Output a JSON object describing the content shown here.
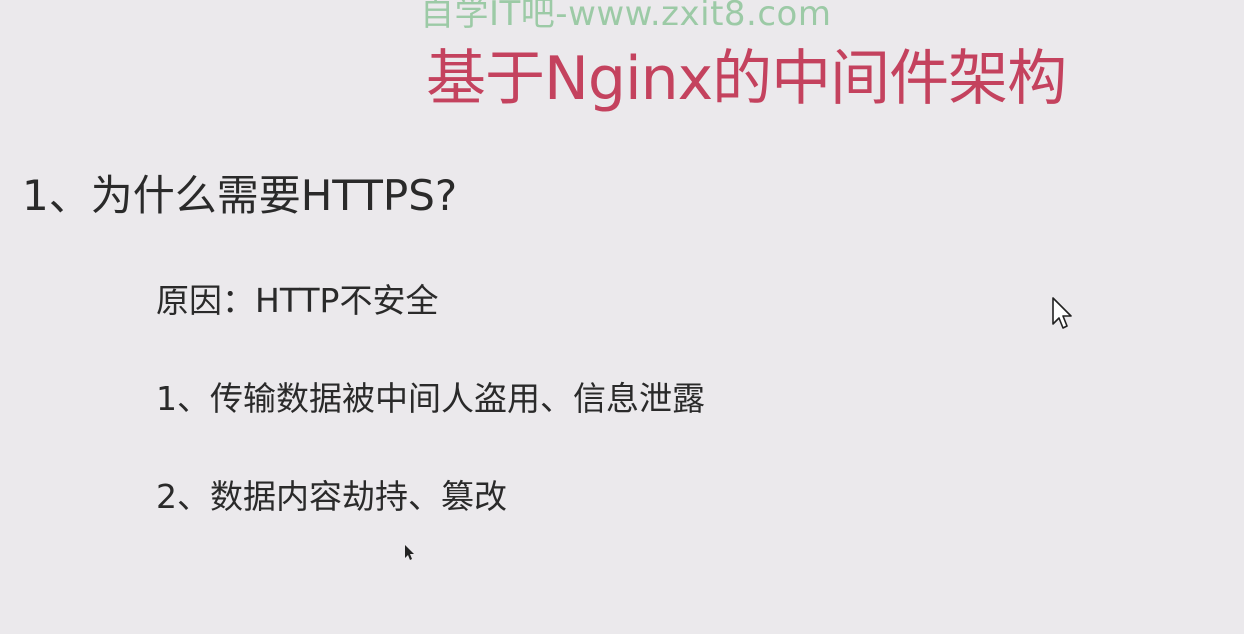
{
  "watermark": "自学IT吧-www.zxit8.com",
  "slide": {
    "title": "基于Nginx的中间件架构",
    "question": "1、为什么需要HTTPS?",
    "points": [
      "原因：HTTP不安全",
      "1、传输数据被中间人盗用、信息泄露",
      "2、数据内容劫持、篡改"
    ]
  },
  "colors": {
    "background": "#ebe9ec",
    "title": "#c4425e",
    "watermark": "#8fc59a",
    "text": "#2a2a2a"
  },
  "icons": {
    "cursor": "mouse-pointer-icon",
    "cursor_small": "mouse-pointer-icon"
  }
}
